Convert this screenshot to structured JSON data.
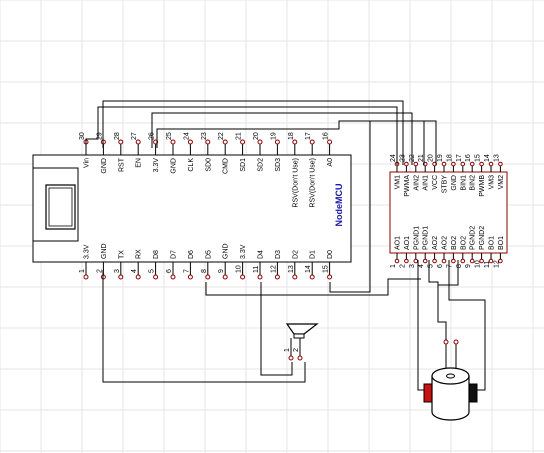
{
  "nodemcu": {
    "title": "NodeMCU",
    "top_pins": [
      {
        "num": "30",
        "label": "Vin"
      },
      {
        "num": "29",
        "label": "GND"
      },
      {
        "num": "28",
        "label": "RST"
      },
      {
        "num": "27",
        "label": "EN"
      },
      {
        "num": "26",
        "label": "3.3V"
      },
      {
        "num": "25",
        "label": "GND"
      },
      {
        "num": "24",
        "label": "CLK"
      },
      {
        "num": "23",
        "label": "SD0"
      },
      {
        "num": "22",
        "label": "CMD"
      },
      {
        "num": "21",
        "label": "SD1"
      },
      {
        "num": "20",
        "label": "SD2"
      },
      {
        "num": "19",
        "label": "SD3"
      },
      {
        "num": "18",
        "label": "RSV(Don't Use)"
      },
      {
        "num": "17",
        "label": "RSV(Don't Use)"
      },
      {
        "num": "16",
        "label": "A0"
      }
    ],
    "bottom_pins": [
      {
        "num": "1",
        "label": "3.3V"
      },
      {
        "num": "2",
        "label": "GND"
      },
      {
        "num": "3",
        "label": "TX"
      },
      {
        "num": "4",
        "label": "RX"
      },
      {
        "num": "5",
        "label": "D8"
      },
      {
        "num": "6",
        "label": "D7"
      },
      {
        "num": "7",
        "label": "D6"
      },
      {
        "num": "8",
        "label": "D5"
      },
      {
        "num": "9",
        "label": "GND"
      },
      {
        "num": "10",
        "label": "3.3V"
      },
      {
        "num": "11",
        "label": "D4"
      },
      {
        "num": "12",
        "label": "D3"
      },
      {
        "num": "13",
        "label": "D2"
      },
      {
        "num": "14",
        "label": "D1"
      },
      {
        "num": "15",
        "label": "D0"
      }
    ]
  },
  "driver": {
    "top_pins": [
      {
        "num": "24",
        "label": "VM1"
      },
      {
        "num": "23",
        "label": "PWMA"
      },
      {
        "num": "22",
        "label": "AIN2"
      },
      {
        "num": "21",
        "label": "AIN1"
      },
      {
        "num": "20",
        "label": "VCC"
      },
      {
        "num": "19",
        "label": "STBY"
      },
      {
        "num": "18",
        "label": "GND"
      },
      {
        "num": "17",
        "label": "BIN1"
      },
      {
        "num": "16",
        "label": "BIN2"
      },
      {
        "num": "15",
        "label": "PWMB"
      },
      {
        "num": "14",
        "label": "VM3"
      },
      {
        "num": "13",
        "label": "VM2"
      }
    ],
    "bottom_pins": [
      {
        "num": "1",
        "label": "AO1"
      },
      {
        "num": "2",
        "label": "AO1"
      },
      {
        "num": "3",
        "label": "PGND1"
      },
      {
        "num": "4",
        "label": "PGND1"
      },
      {
        "num": "5",
        "label": "AO2"
      },
      {
        "num": "6",
        "label": "AO2"
      },
      {
        "num": "7",
        "label": "BO2"
      },
      {
        "num": "8",
        "label": "BO2"
      },
      {
        "num": "9",
        "label": "PGND2"
      },
      {
        "num": "10",
        "label": "PGND2"
      },
      {
        "num": "11",
        "label": "BO1"
      },
      {
        "num": "12",
        "label": "BO1"
      }
    ]
  },
  "speaker": {
    "pins": [
      "1",
      "2"
    ]
  },
  "colors": {
    "line": "#000000",
    "component": "#8b0000",
    "motor_tab": "#cc1111",
    "grid": "#e6e6e6"
  }
}
